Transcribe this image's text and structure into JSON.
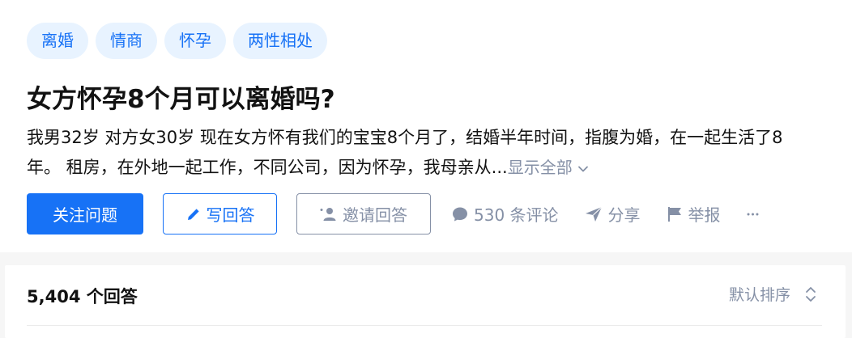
{
  "topics": [
    "离婚",
    "情商",
    "怀孕",
    "两性相处"
  ],
  "question": {
    "title": "女方怀孕8个月可以离婚吗?",
    "desc_line1": "我男32岁 对方女30岁 现在女方怀有我们的宝宝8个月了，结婚半年时间，指腹为婚，在一起生活了8",
    "desc_line2": "年。 租房，在外地一起工作，不同公司，因为怀孕，我母亲从...",
    "show_all": "显示全部"
  },
  "actions": {
    "follow": "关注问题",
    "write": "写回答",
    "invite": "邀请回答",
    "comments": "530 条评论",
    "share": "分享",
    "report": "举报"
  },
  "answers": {
    "count": "5,404 个回答",
    "sort": "默认排序"
  },
  "icons": {
    "write": "pencil-icon",
    "invite": "add-user-icon",
    "comments": "comment-bubble-icon",
    "share": "paper-plane-icon",
    "report": "flag-icon",
    "more": "ellipsis-icon",
    "show_all": "chevron-down-icon",
    "sort": "sort-updown-icon"
  },
  "colors": {
    "brand": "#1772f6",
    "muted": "#8590a6",
    "tag_bg": "#e8f3ff",
    "text": "#121212"
  }
}
